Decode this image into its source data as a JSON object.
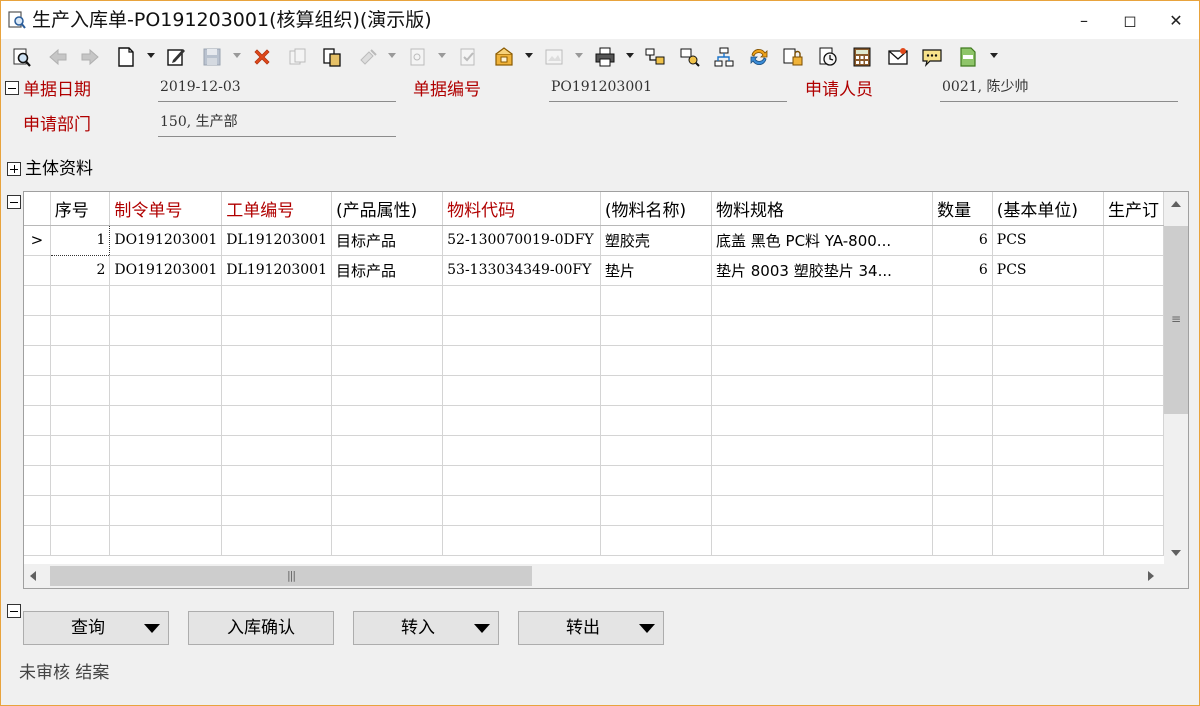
{
  "window": {
    "title": "生产入库单-PO191203001(核算组织)(演示版)",
    "controls": {
      "minimize": "–",
      "maximize": "◻",
      "close": "✕"
    }
  },
  "header": {
    "fields": [
      {
        "label": "单据日期",
        "value": "2019-12-03"
      },
      {
        "label": "单据编号",
        "value": "PO191203001"
      },
      {
        "label": "申请人员",
        "value": "0021, 陈少帅"
      },
      {
        "label": "申请部门",
        "value": "150, 生产部"
      }
    ],
    "section_main": "主体资料"
  },
  "grid": {
    "columns": [
      "序号",
      "制令单号",
      "工单编号",
      "(产品属性)",
      "物料代码",
      "(物料名称)",
      "物料规格",
      "数量",
      "(基本单位)",
      "生产订"
    ],
    "rows": [
      [
        "1",
        "DO191203001",
        "DL191203001",
        "目标产品",
        "52-130070019-0DFY",
        "塑胶壳",
        "底盖 黑色 PC料 YA-800...",
        "6",
        "PCS",
        ""
      ],
      [
        "2",
        "DO191203001",
        "DL191203001",
        "目标产品",
        "53-133034349-00FY",
        "垫片",
        "垫片 8003 塑胶垫片 34...",
        "6",
        "PCS",
        ""
      ]
    ],
    "current_row_marker": ">",
    "hscroll_grip": "|||",
    "vscroll_grip": "≡"
  },
  "buttons": {
    "query": "查询",
    "confirm": "入库确认",
    "transfer_in": "转入",
    "transfer_out": "转出"
  },
  "status": "未审核 结案"
}
